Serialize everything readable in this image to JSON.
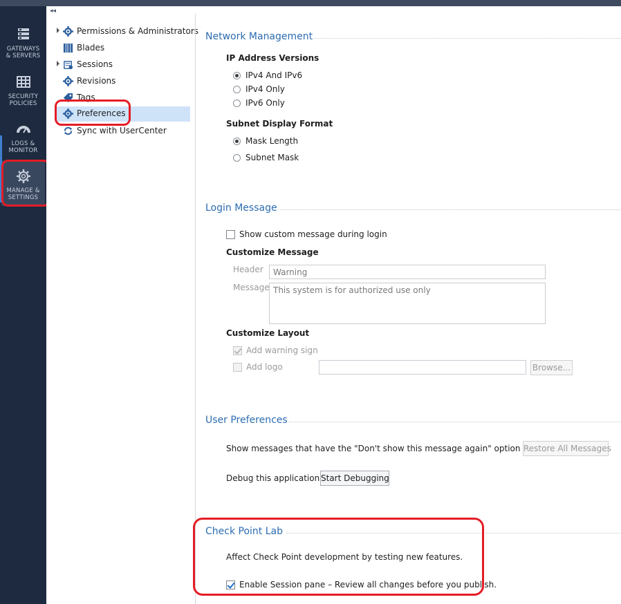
{
  "left_nav": {
    "items": [
      {
        "label_line1": "GATEWAYS",
        "label_line2": "& SERVERS",
        "icon": "gateways-servers-icon"
      },
      {
        "label_line1": "SECURITY",
        "label_line2": "POLICIES",
        "icon": "security-policies-icon"
      },
      {
        "label_line1": "LOGS &",
        "label_line2": "MONITOR",
        "icon": "logs-monitor-icon"
      },
      {
        "label_line1": "MANAGE &",
        "label_line2": "SETTINGS",
        "icon": "gear-icon"
      }
    ]
  },
  "tree": {
    "collapse_glyph": "◂◂",
    "items": [
      {
        "label": "Permissions & Administrators",
        "icon": "gear-icon",
        "expandable": true
      },
      {
        "label": "Blades",
        "icon": "blades-icon",
        "expandable": false
      },
      {
        "label": "Sessions",
        "icon": "sessions-icon",
        "expandable": true
      },
      {
        "label": "Revisions",
        "icon": "gear-icon",
        "expandable": false
      },
      {
        "label": "Tags",
        "icon": "tag-icon",
        "expandable": false
      },
      {
        "label": "Preferences",
        "icon": "gear-icon",
        "expandable": false,
        "selected": true
      },
      {
        "label": "Sync with UserCenter",
        "icon": "sync-icon",
        "expandable": false
      }
    ]
  },
  "network": {
    "title": "Network Management",
    "ip_versions_label": "IP Address Versions",
    "ip_options": [
      "IPv4 And IPv6",
      "IPv4 Only",
      "IPv6 Only"
    ],
    "ip_selected": "IPv4 And IPv6",
    "subnet_label": "Subnet Display Format",
    "subnet_options": [
      "Mask Length",
      "Subnet Mask"
    ],
    "subnet_selected": "Mask Length"
  },
  "login": {
    "title": "Login Message",
    "show_custom_label": "Show custom message during login",
    "show_custom_checked": false,
    "customize_message_label": "Customize Message",
    "header_label": "Header",
    "header_value": "Warning",
    "message_label": "Message",
    "message_value": "This system is for authorized use only",
    "customize_layout_label": "Customize Layout",
    "add_warning_label": "Add warning sign",
    "add_warning_checked": true,
    "add_logo_label": "Add logo",
    "add_logo_checked": false,
    "logo_path_value": "",
    "browse_label": "Browse..."
  },
  "user_prefs": {
    "title": "User Preferences",
    "messages_text": "Show messages that have the \"Don't show this message again\" option selected",
    "restore_label": "Restore All Messages",
    "debug_label": "Debug this application:",
    "start_debug_label": "Start Debugging"
  },
  "lab": {
    "title": "Check Point Lab",
    "description": "Affect Check Point development  by testing new features.",
    "session_pane_label": "Enable Session pane – Review all changes before you publish.",
    "session_pane_checked": true
  },
  "colors": {
    "accent": "#2c6cb0",
    "nav_bg": "#1d2a3f",
    "highlight": "#e41c25",
    "selection": "#cfe3f8"
  }
}
